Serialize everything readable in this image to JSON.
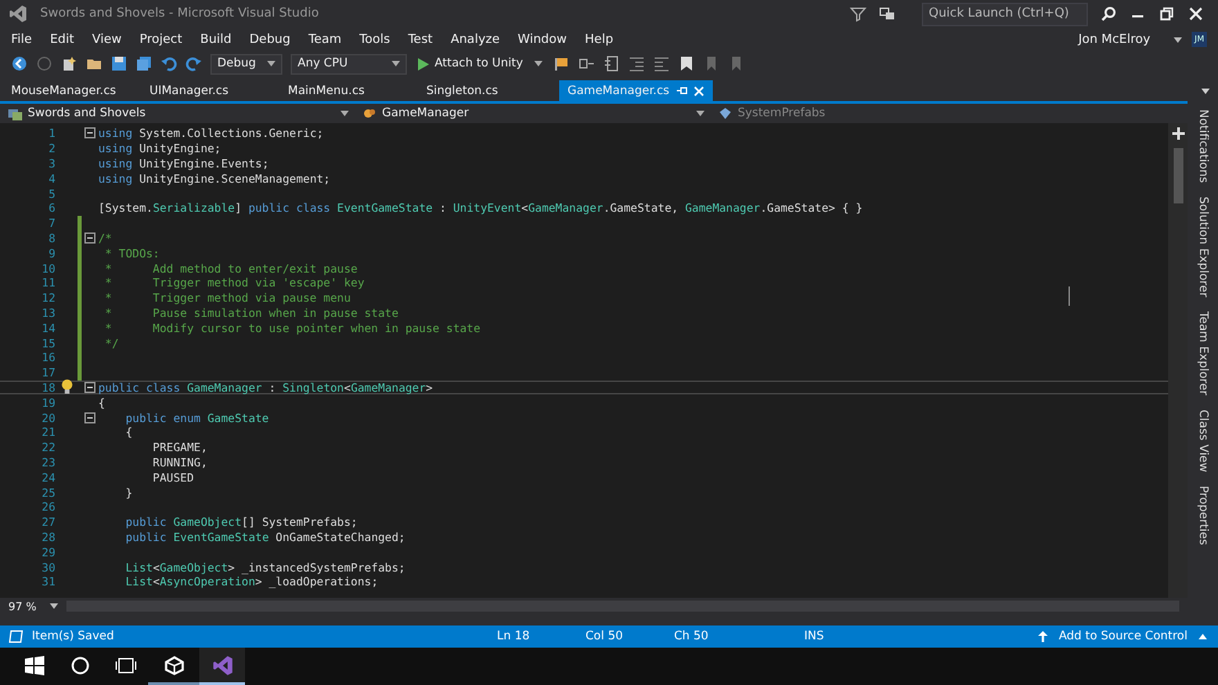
{
  "window": {
    "title": "Swords and Shovels - Microsoft Visual Studio",
    "quick_launch": {
      "placeholder": "Quick Launch (Ctrl+Q)"
    }
  },
  "menu": [
    "File",
    "Edit",
    "View",
    "Project",
    "Build",
    "Debug",
    "Team",
    "Tools",
    "Test",
    "Analyze",
    "Window",
    "Help"
  ],
  "user": {
    "name": "Jon McElroy",
    "initials": "JM"
  },
  "toolbar": {
    "configuration": "Debug",
    "platform": "Any CPU",
    "run_button": "Attach to Unity"
  },
  "tabs": [
    {
      "label": "MouseManager.cs",
      "selected": false
    },
    {
      "label": "UIManager.cs",
      "selected": false
    },
    {
      "label": "MainMenu.cs",
      "selected": false
    },
    {
      "label": "Singleton.cs",
      "selected": false
    },
    {
      "label": "GameManager.cs",
      "selected": true
    }
  ],
  "navigation": {
    "project": "Swords and Shovels",
    "type": "GameManager",
    "member": "SystemPrefabs"
  },
  "editor": {
    "lines": [
      {
        "number": "1",
        "fold": true,
        "changed": false,
        "current": false,
        "lightbulb": false,
        "tokens": [
          {
            "kind": "kw",
            "text": "using"
          },
          {
            "kind": "plain",
            "text": " System.Collections.Generic;"
          }
        ]
      },
      {
        "number": "2",
        "fold": false,
        "changed": false,
        "current": false,
        "lightbulb": false,
        "tokens": [
          {
            "kind": "kw",
            "text": "using"
          },
          {
            "kind": "plain",
            "text": " UnityEngine;"
          }
        ]
      },
      {
        "number": "3",
        "fold": false,
        "changed": false,
        "current": false,
        "lightbulb": false,
        "tokens": [
          {
            "kind": "kw",
            "text": "using"
          },
          {
            "kind": "plain",
            "text": " UnityEngine.Events;"
          }
        ]
      },
      {
        "number": "4",
        "fold": false,
        "changed": false,
        "current": false,
        "lightbulb": false,
        "tokens": [
          {
            "kind": "kw",
            "text": "using"
          },
          {
            "kind": "plain",
            "text": " UnityEngine.SceneManagement;"
          }
        ]
      },
      {
        "number": "5",
        "fold": false,
        "changed": false,
        "current": false,
        "lightbulb": false
      },
      {
        "number": "6",
        "fold": false,
        "changed": false,
        "current": false,
        "lightbulb": false,
        "tokens": [
          {
            "kind": "plain",
            "text": "[System."
          },
          {
            "kind": "type",
            "text": "Serializable"
          },
          {
            "kind": "plain",
            "text": "] "
          },
          {
            "kind": "kw",
            "text": "public class "
          },
          {
            "kind": "type",
            "text": "EventGameState"
          },
          {
            "kind": "plain",
            "text": " : "
          },
          {
            "kind": "type",
            "text": "UnityEvent"
          },
          {
            "kind": "plain",
            "text": "<"
          },
          {
            "kind": "type",
            "text": "GameManager"
          },
          {
            "kind": "plain",
            "text": ".GameState, "
          },
          {
            "kind": "type",
            "text": "GameManager"
          },
          {
            "kind": "plain",
            "text": ".GameState> { }"
          }
        ]
      },
      {
        "number": "7",
        "fold": false,
        "changed": true,
        "current": false,
        "lightbulb": false
      },
      {
        "number": "8",
        "fold": true,
        "changed": true,
        "current": false,
        "lightbulb": false,
        "tokens": [
          {
            "kind": "comment",
            "text": "/*"
          }
        ]
      },
      {
        "number": "9",
        "fold": false,
        "changed": true,
        "current": false,
        "lightbulb": false,
        "tokens": [
          {
            "kind": "comment",
            "text": " * TODOs:"
          }
        ]
      },
      {
        "number": "10",
        "fold": false,
        "changed": true,
        "current": false,
        "lightbulb": false,
        "tokens": [
          {
            "kind": "comment",
            "text": " *      Add method to enter/exit pause"
          }
        ]
      },
      {
        "number": "11",
        "fold": false,
        "changed": true,
        "current": false,
        "lightbulb": false,
        "tokens": [
          {
            "kind": "comment",
            "text": " *      Trigger method via 'escape' key"
          }
        ]
      },
      {
        "number": "12",
        "fold": false,
        "changed": true,
        "current": false,
        "lightbulb": false,
        "tokens": [
          {
            "kind": "comment",
            "text": " *      Trigger method via pause menu"
          }
        ]
      },
      {
        "number": "13",
        "fold": false,
        "changed": true,
        "current": false,
        "lightbulb": false,
        "tokens": [
          {
            "kind": "comment",
            "text": " *      Pause simulation when in pause state"
          }
        ]
      },
      {
        "number": "14",
        "fold": false,
        "changed": true,
        "current": false,
        "lightbulb": false,
        "tokens": [
          {
            "kind": "comment",
            "text": " *      Modify cursor to use pointer when in pause state"
          }
        ]
      },
      {
        "number": "15",
        "fold": false,
        "changed": true,
        "current": false,
        "lightbulb": false,
        "tokens": [
          {
            "kind": "comment",
            "text": " */"
          }
        ]
      },
      {
        "number": "16",
        "fold": false,
        "changed": true,
        "current": false,
        "lightbulb": false
      },
      {
        "number": "17",
        "fold": false,
        "changed": true,
        "current": false,
        "lightbulb": false
      },
      {
        "number": "18",
        "fold": true,
        "changed": false,
        "current": true,
        "lightbulb": true,
        "tokens": [
          {
            "kind": "kw",
            "text": "public class "
          },
          {
            "kind": "type",
            "text": "GameManager"
          },
          {
            "kind": "plain",
            "text": " : "
          },
          {
            "kind": "type",
            "text": "Singleton"
          },
          {
            "kind": "plain",
            "text": "<"
          },
          {
            "kind": "type",
            "text": "GameManager"
          },
          {
            "kind": "plain",
            "text": ">"
          }
        ]
      },
      {
        "number": "19",
        "fold": false,
        "changed": false,
        "current": false,
        "lightbulb": false,
        "tokens": [
          {
            "kind": "plain",
            "text": "{"
          }
        ]
      },
      {
        "number": "20",
        "fold": true,
        "changed": false,
        "current": false,
        "lightbulb": false,
        "tokens": [
          {
            "kind": "kw",
            "text": "    public enum "
          },
          {
            "kind": "type",
            "text": "GameState"
          }
        ]
      },
      {
        "number": "21",
        "fold": false,
        "changed": false,
        "current": false,
        "lightbulb": false,
        "tokens": [
          {
            "kind": "plain",
            "text": "    {"
          }
        ]
      },
      {
        "number": "22",
        "fold": false,
        "changed": false,
        "current": false,
        "lightbulb": false,
        "tokens": [
          {
            "kind": "plain",
            "text": "        PREGAME,"
          }
        ]
      },
      {
        "number": "23",
        "fold": false,
        "changed": false,
        "current": false,
        "lightbulb": false,
        "tokens": [
          {
            "kind": "plain",
            "text": "        RUNNING,"
          }
        ]
      },
      {
        "number": "24",
        "fold": false,
        "changed": false,
        "current": false,
        "lightbulb": false,
        "tokens": [
          {
            "kind": "plain",
            "text": "        PAUSED"
          }
        ]
      },
      {
        "number": "25",
        "fold": false,
        "changed": false,
        "current": false,
        "lightbulb": false,
        "tokens": [
          {
            "kind": "plain",
            "text": "    }"
          }
        ]
      },
      {
        "number": "26",
        "fold": false,
        "changed": false,
        "current": false,
        "lightbulb": false
      },
      {
        "number": "27",
        "fold": false,
        "changed": false,
        "current": false,
        "lightbulb": false,
        "tokens": [
          {
            "kind": "kw",
            "text": "    public "
          },
          {
            "kind": "type",
            "text": "GameObject"
          },
          {
            "kind": "plain",
            "text": "[] SystemPrefabs;"
          }
        ]
      },
      {
        "number": "28",
        "fold": false,
        "changed": false,
        "current": false,
        "lightbulb": false,
        "tokens": [
          {
            "kind": "kw",
            "text": "    public "
          },
          {
            "kind": "type",
            "text": "EventGameState"
          },
          {
            "kind": "plain",
            "text": " OnGameStateChanged;"
          }
        ]
      },
      {
        "number": "29",
        "fold": false,
        "changed": false,
        "current": false,
        "lightbulb": false
      },
      {
        "number": "30",
        "fold": false,
        "changed": false,
        "current": false,
        "lightbulb": false,
        "tokens": [
          {
            "kind": "type",
            "text": "    List"
          },
          {
            "kind": "plain",
            "text": "<"
          },
          {
            "kind": "type",
            "text": "GameObject"
          },
          {
            "kind": "plain",
            "text": "> _instancedSystemPrefabs;"
          }
        ]
      },
      {
        "number": "31",
        "fold": false,
        "changed": false,
        "current": false,
        "lightbulb": false,
        "tokens": [
          {
            "kind": "type",
            "text": "    List"
          },
          {
            "kind": "plain",
            "text": "<"
          },
          {
            "kind": "type",
            "text": "AsyncOperation"
          },
          {
            "kind": "plain",
            "text": "> _loadOperations;"
          }
        ]
      }
    ],
    "zoom": "97 %"
  },
  "side_tabs": [
    "Notifications",
    "Solution Explorer",
    "Team Explorer",
    "Class View",
    "Properties"
  ],
  "status_bar": {
    "message": "Item(s) Saved",
    "line": "Ln 18",
    "column": "Col 50",
    "char": "Ch 50",
    "mode": "INS",
    "source_control": "Add to Source Control"
  },
  "taskbar": [
    {
      "kind": "start",
      "active": false
    },
    {
      "kind": "search",
      "active": false
    },
    {
      "kind": "taskview",
      "active": false
    },
    {
      "kind": "unity",
      "active": false
    },
    {
      "kind": "vs",
      "active": true
    }
  ]
}
